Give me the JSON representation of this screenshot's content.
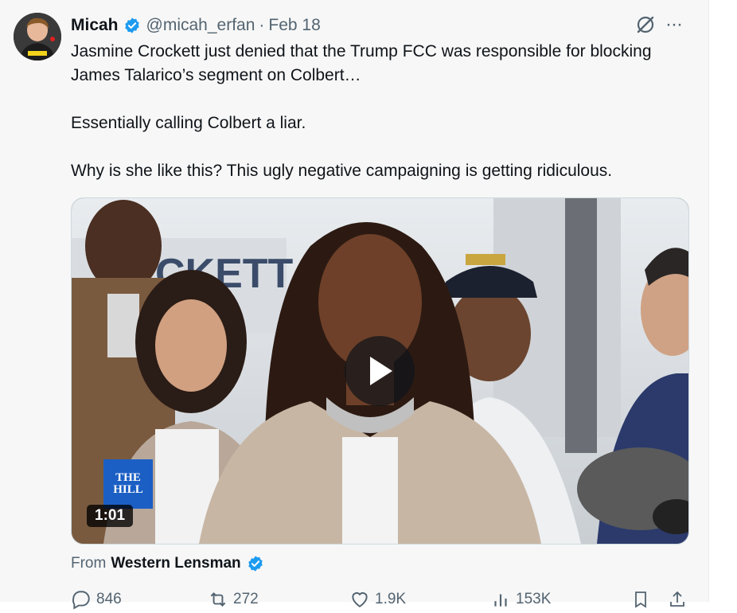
{
  "post": {
    "author_name": "Micah",
    "handle": "@micah_erfan",
    "separator": "·",
    "date": "Feb 18",
    "more_label": "···",
    "paragraphs": [
      "Jasmine Crockett just denied that the Trump FCC was responsible for blocking James Talarico’s segment on Colbert…",
      "Essentially calling Colbert a liar.",
      "Why is she like this? This ugly negative campaigning is getting ridiculous."
    ]
  },
  "video": {
    "duration": "1:01",
    "logo_line1": "THE",
    "logo_line2": "HILL",
    "background_sign_text": "CKETT"
  },
  "source": {
    "from_label": "From",
    "name": "Western Lensman"
  },
  "actions": {
    "replies": "846",
    "reposts": "272",
    "likes": "1.9K",
    "views": "153K"
  },
  "colors": {
    "verified_blue": "#1d9bf0",
    "secondary_text": "#536471",
    "hill_blue": "#1b5fc4"
  },
  "icons": [
    "verified-badge-icon",
    "grok-icon",
    "more-icon",
    "play-icon",
    "reply-icon",
    "repost-icon",
    "like-icon",
    "views-icon",
    "bookmark-icon",
    "share-icon"
  ]
}
